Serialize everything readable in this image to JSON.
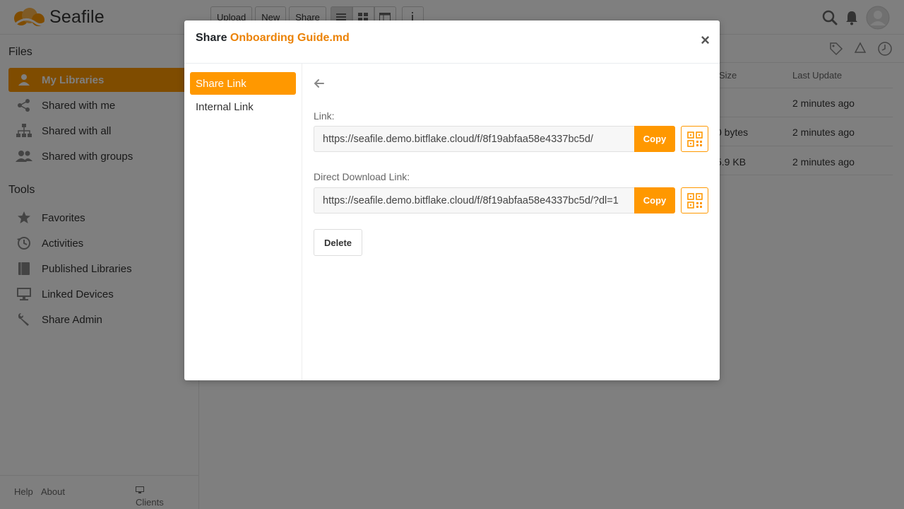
{
  "app": {
    "logo_text": "Seafile"
  },
  "toolbar": {
    "upload": "Upload",
    "new": "New",
    "share": "Share"
  },
  "sidebar": {
    "files_heading": "Files",
    "files_items": [
      {
        "label": "My Libraries",
        "icon": "user-icon",
        "active": true
      },
      {
        "label": "Shared with me",
        "icon": "share-nodes-icon"
      },
      {
        "label": "Shared with all",
        "icon": "org-chart-icon"
      },
      {
        "label": "Shared with groups",
        "icon": "group-icon"
      }
    ],
    "tools_heading": "Tools",
    "tools_items": [
      {
        "label": "Favorites",
        "icon": "star-icon"
      },
      {
        "label": "Activities",
        "icon": "history-icon"
      },
      {
        "label": "Published Libraries",
        "icon": "book-icon"
      },
      {
        "label": "Linked Devices",
        "icon": "monitor-icon"
      },
      {
        "label": "Share Admin",
        "icon": "wrench-icon"
      }
    ],
    "footer": {
      "help": "Help",
      "about": "About",
      "clients": "Clients"
    }
  },
  "table": {
    "headers": {
      "size": "Size",
      "last_update": "Last Update"
    },
    "rows": [
      {
        "size": "",
        "last_update": "2 minutes ago"
      },
      {
        "size": "0 bytes",
        "last_update": "2 minutes ago"
      },
      {
        "size": "5.9 KB",
        "last_update": "2 minutes ago"
      }
    ]
  },
  "modal": {
    "title_prefix": "Share",
    "file_name": "Onboarding Guide.md",
    "close": "×",
    "nav": [
      {
        "label": "Share Link",
        "active": true
      },
      {
        "label": "Internal Link"
      }
    ],
    "link_label": "Link:",
    "link_value": "https://seafile.demo.bitflake.cloud/f/8f19abfaa58e4337bc5d/",
    "direct_label": "Direct Download Link:",
    "direct_value": "https://seafile.demo.bitflake.cloud/f/8f19abfaa58e4337bc5d/?dl=1",
    "copy_label": "Copy",
    "delete_label": "Delete"
  },
  "colors": {
    "accent": "#ff9800",
    "file_name": "#eb8205"
  }
}
